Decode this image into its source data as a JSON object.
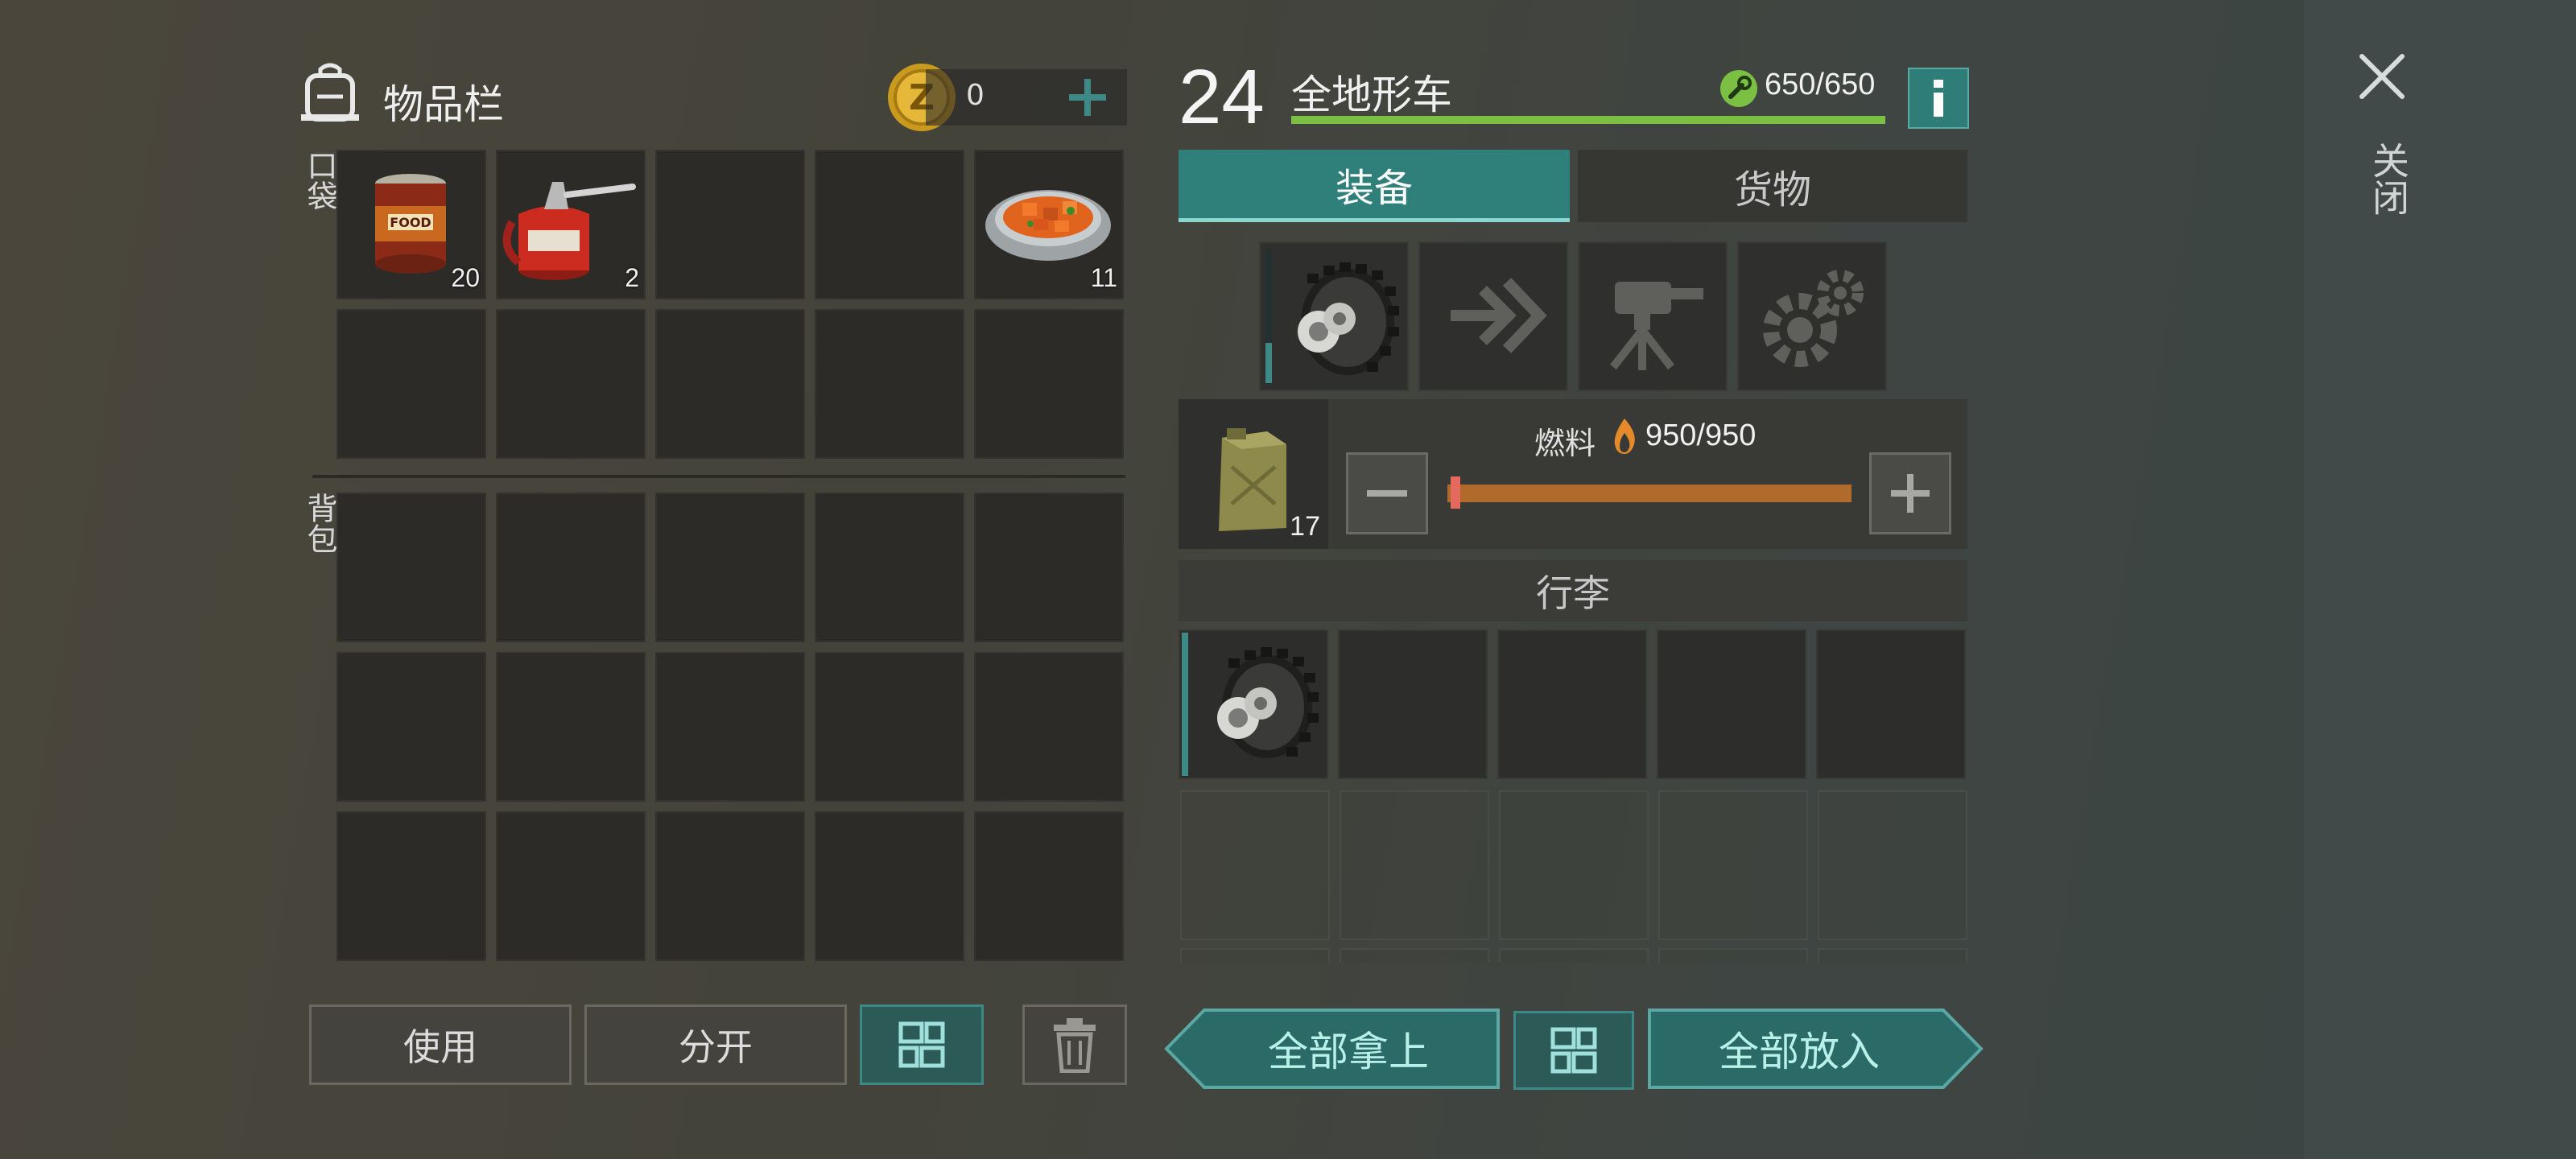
{
  "inventory": {
    "title": "物品栏",
    "coin_count": "0",
    "pocket_label": "口袋",
    "backpack_label": "背包",
    "pocket_items": [
      {
        "icon": "canned-food-icon",
        "count": "20"
      },
      {
        "icon": "oil-can-icon",
        "count": "2"
      },
      {
        "icon": "",
        "count": ""
      },
      {
        "icon": "",
        "count": ""
      },
      {
        "icon": "stew-bowl-icon",
        "count": "11"
      }
    ]
  },
  "actions": {
    "use": "使用",
    "split": "分开",
    "take_all": "全部拿上",
    "put_all": "全部放入"
  },
  "vehicle": {
    "level": "24",
    "name": "全地形车",
    "durability": "650/650",
    "durability_fraction": 1.0,
    "tabs": {
      "equipment": "装备",
      "cargo": "货物"
    },
    "active_tab": "equipment",
    "fuel_label": "燃料",
    "fuel_value": "950/950",
    "fuel_fraction": 1.0,
    "jerrycan_count": "17",
    "luggage_label": "行李"
  },
  "close_label": "关闭",
  "colors": {
    "accent_teal": "#3d8985",
    "durability_green": "#7bc043",
    "fuel_orange": "#b06a2c",
    "info_button": "#2e7d78"
  }
}
